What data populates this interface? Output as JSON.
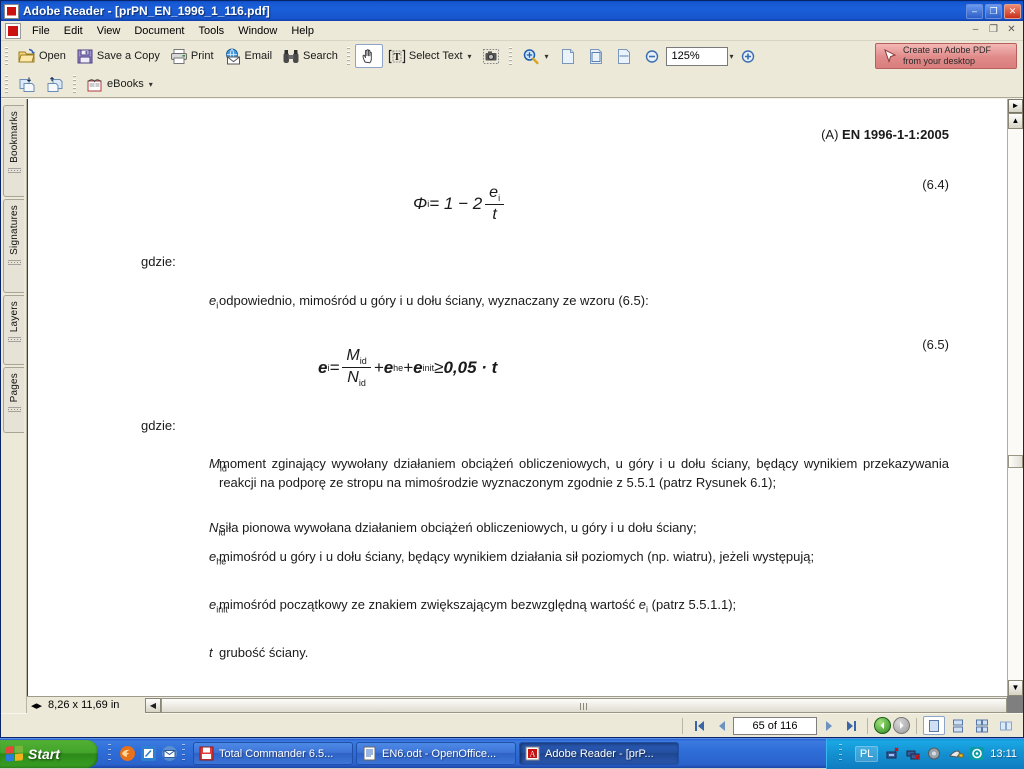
{
  "window": {
    "title": "Adobe Reader - [prPN_EN_1996_1_116.pdf]",
    "minimize_label": "–",
    "maximize_label": "❐",
    "close_label": "✕",
    "mdi_minimize_label": "–",
    "mdi_restore_label": "❐",
    "mdi_close_label": "✕"
  },
  "menu": {
    "items": [
      {
        "label": "File"
      },
      {
        "label": "Edit"
      },
      {
        "label": "View"
      },
      {
        "label": "Document"
      },
      {
        "label": "Tools"
      },
      {
        "label": "Window"
      },
      {
        "label": "Help"
      }
    ]
  },
  "toolbar": {
    "open_label": "Open",
    "save_copy_label": "Save a Copy",
    "print_label": "Print",
    "email_label": "Email",
    "search_label": "Search",
    "select_text_label": "Select Text",
    "zoom_value": "125%",
    "ebooks_label": "eBooks",
    "dropdown_caret": "▾",
    "banner_line1": "Create an Adobe PDF",
    "banner_line2": "from your desktop"
  },
  "navpanel": {
    "tabs": [
      {
        "label": "Bookmarks"
      },
      {
        "label": "Signatures"
      },
      {
        "label": "Layers"
      },
      {
        "label": "Pages"
      }
    ]
  },
  "document": {
    "header_prefix": "(A) ",
    "header_standard": "EN 1996-1-1:2005",
    "equation_64_number": "(6.4)",
    "equation_65_number": "(6.5)",
    "gdzie_1": "gdzie:",
    "gdzie_2": "gdzie:",
    "eq64": {
      "lhs": "Φ",
      "lhs_sub": "i",
      "rel": " = 1 − 2 ",
      "frac_num": "e",
      "frac_num_sub": "i",
      "frac_den": "t"
    },
    "eq65": {
      "lhs": "e",
      "lhs_sub": "i",
      "eq": " = ",
      "frac_num": "M",
      "frac_num_sub": "id",
      "frac_den": "N",
      "frac_den_sub": "id",
      "term2_plus": " + ",
      "term2": "e",
      "term2_sub": "he",
      "term3_plus": " + ",
      "term3": "e",
      "term3_sub": "init",
      "ge": " ≥ ",
      "value": "0,05 · t"
    },
    "definitions_1": [
      {
        "symbol": "e",
        "symbol_sub": "i",
        "text": "odpowiednio, mimośród u góry i u dołu ściany, wyznaczany ze wzoru (6.5):"
      }
    ],
    "definitions_2": [
      {
        "symbol": "M",
        "symbol_sub": "id",
        "text": "moment zginający wywołany działaniem obciążeń obliczeniowych, u góry i u dołu ściany, będący wynikiem przekazywania reakcji na podporę ze stropu na mimośrodzie wyznaczonym zgodnie z 5.5.1 (patrz Rysunek 6.1);"
      },
      {
        "symbol": "N",
        "symbol_sub": "id",
        "text": "siła pionowa wywołana działaniem obciążeń obliczeniowych, u góry i u dołu ściany;"
      },
      {
        "symbol": "e",
        "symbol_sub": "he",
        "text": "mimośród u góry i u dołu ściany, będący wynikiem działania sił poziomych (np. wiatru), jeżeli występują;"
      },
      {
        "symbol": "e",
        "symbol_sub": "init",
        "text_a": "mimośród początkowy ze znakiem zwiększającym bezwzględną wartość ",
        "text_sym": "e",
        "text_sym_sub": "i",
        "text_b": " (patrz 5.5.1.1);"
      },
      {
        "symbol": "t",
        "symbol_sub": "",
        "text": "grubość ściany."
      }
    ]
  },
  "status": {
    "page_size": "8,26 x 11,69 in",
    "page_field": "65 of 116",
    "first_page_label": "⏮",
    "prev_page_label": "◀",
    "next_page_label": "▶",
    "last_page_label": "⏭",
    "back_label": "←",
    "forward_label": "→"
  },
  "taskbar": {
    "start_label": "Start",
    "tasks": [
      {
        "label": "Total Commander 6.5...",
        "active": false
      },
      {
        "label": "EN6.odt - OpenOffice...",
        "active": false
      },
      {
        "label": "Adobe Reader - [prP...",
        "active": true
      }
    ],
    "language": "PL",
    "clock": "13:11"
  }
}
